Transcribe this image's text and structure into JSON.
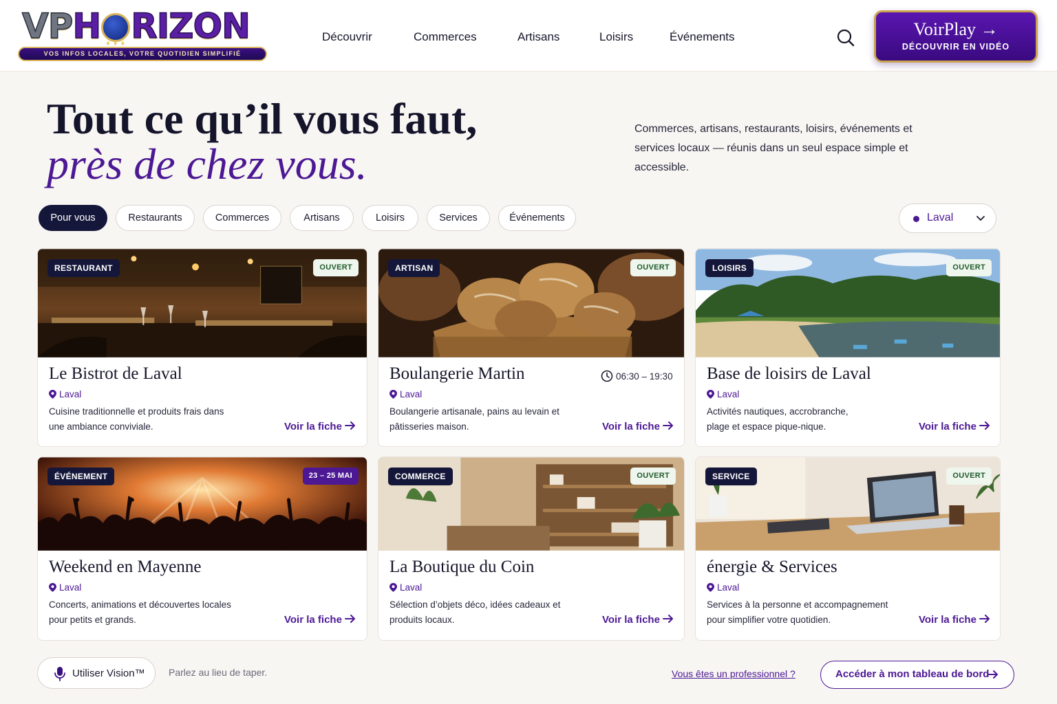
{
  "brand": {
    "logo_text": "VPHORIZON",
    "tagline": "VOS INFOS LOCALES, VOTRE QUOTIDIEN SIMPLIFIÉ",
    "accent": "#4c1894",
    "navy": "#15173a",
    "gold": "#c9a24e"
  },
  "nav": {
    "items": [
      "Découvrir",
      "Commerces",
      "Artisans",
      "Loisirs",
      "Événements"
    ],
    "search_icon": "search-icon"
  },
  "voirplay": {
    "title": "VoirPlay →",
    "subtitle": "DÉCOUVRIR EN VIDÉO"
  },
  "hero": {
    "line1": "Tout ce qu’il vous faut,",
    "line2": "près de chez vous.",
    "description": "Commerces, artisans, restaurants, loisirs, événements et services locaux — réunis dans un seul espace simple et accessible."
  },
  "filters": {
    "chips": [
      "Pour vous",
      "Restaurants",
      "Commerces",
      "Artisans",
      "Loisirs",
      "Services",
      "Événements"
    ],
    "active": "Pour vous",
    "city": "Laval"
  },
  "cards": [
    {
      "category": "RESTAURANT",
      "status": "OUVERT",
      "title": "Le Bistrot de Laval",
      "location": "Laval",
      "description": "Cuisine traditionnelle et produits frais dans une ambiance conviviale.",
      "link": "Voir la fiche"
    },
    {
      "category": "ARTISAN",
      "status": "OUVERT",
      "title": "Boulangerie Martin",
      "hours": "06:30 – 19:30",
      "location": "Laval",
      "description": "Boulangerie artisanale, pains au levain et pâtisseries maison.",
      "link": "Voir la fiche"
    },
    {
      "category": "LOISIRS",
      "status": "OUVERT",
      "title": "Base de loisirs de Laval",
      "location": "Laval",
      "description": "Activités nautiques, accrobranche, plage et espace pique-nique.",
      "link": "Voir la fiche"
    },
    {
      "category": "ÉVÉNEMENT",
      "status": "23 – 25 MAI",
      "title": "Weekend en Mayenne",
      "location": "Laval",
      "description": "Concerts, animations et découvertes locales pour petits et grands.",
      "link": "Voir la fiche"
    },
    {
      "category": "COMMERCE",
      "status": "OUVERT",
      "title": "La Boutique du Coin",
      "location": "Laval",
      "description": "Sélection d’objets déco, idées cadeaux et produits locaux.",
      "link": "Voir la fiche"
    },
    {
      "category": "SERVICE",
      "status": "OUVERT",
      "title": "énergie & Services",
      "location": "Laval",
      "description": "Services à la personne et accompagnement pour simplifier votre quotidien.",
      "link": "Voir la fiche"
    }
  ],
  "footer": {
    "vision_label": "Utiliser Vision™",
    "vision_hint": "Parlez au lieu de taper.",
    "pro_link": "Vous êtes un professionnel ?",
    "dashboard_button": "Accéder à mon tableau de bord"
  }
}
